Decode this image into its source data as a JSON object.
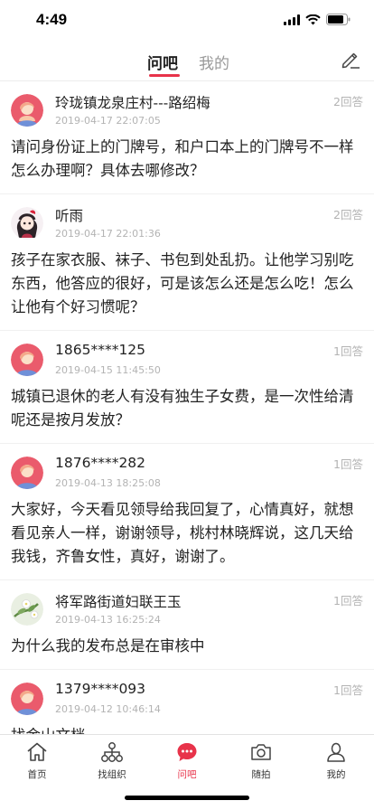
{
  "status": {
    "time": "4:49"
  },
  "tabs": {
    "qa": "问吧",
    "mine": "我的"
  },
  "posts": [
    {
      "author": "玲珑镇龙泉庄村---路绍梅",
      "time": "2019-04-17 22:07:05",
      "count": "2回答",
      "avatar": "woman-avatar",
      "text": "请问身份证上的门牌号，和户口本上的门牌号不一样怎么办理啊？具体去哪修改？"
    },
    {
      "author": "听雨",
      "time": "2019-04-17 22:01:36",
      "count": "2回答",
      "avatar": "girl-avatar",
      "text": "孩子在家衣服、袜子、书包到处乱扔。让他学习别吃东西，他答应的很好，可是该怎么还是怎么吃！怎么让他有个好习惯呢？"
    },
    {
      "author": "1865****125",
      "time": "2019-04-15 11:45:50",
      "count": "1回答",
      "avatar": "woman-avatar",
      "text": "城镇已退休的老人有没有独生子女费，是一次性给清呢还是按月发放？"
    },
    {
      "author": "1876****282",
      "time": "2019-04-13 18:25:08",
      "count": "1回答",
      "avatar": "woman-avatar",
      "text": "大家好，今天看见领导给我回复了，心情真好，就想看见亲人一样，谢谢领导，桃村林晓辉说，这几天给我钱，齐鲁女性，真好，谢谢了。"
    },
    {
      "author": "将军路街道妇联王玉",
      "time": "2019-04-13 16:25:24",
      "count": "1回答",
      "avatar": "flower-avatar",
      "text": "为什么我的发布总是在审核中"
    },
    {
      "author": "1379****093",
      "time": "2019-04-12 10:46:14",
      "count": "1回答",
      "avatar": "woman-avatar",
      "text": "找金山文档"
    }
  ],
  "bottom_nav": [
    {
      "label": "首页",
      "icon": "home-icon"
    },
    {
      "label": "找组织",
      "icon": "org-icon"
    },
    {
      "label": "问吧",
      "icon": "chat-icon"
    },
    {
      "label": "随拍",
      "icon": "camera-icon"
    },
    {
      "label": "我的",
      "icon": "user-icon"
    }
  ],
  "colors": {
    "accent": "#e8334a",
    "muted": "#b3b3b3"
  }
}
